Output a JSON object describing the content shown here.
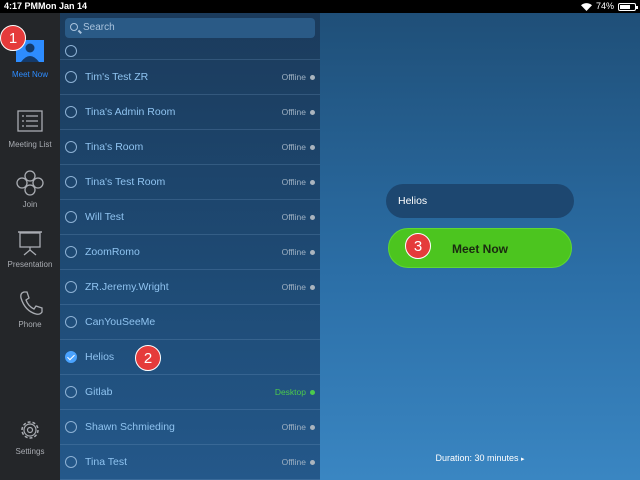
{
  "status_bar": {
    "time": "4:17 PM",
    "date": "Mon Jan 14",
    "battery": "74%",
    "battery_level": 0.74
  },
  "rail": {
    "items": [
      {
        "label": "Meet Now",
        "icon": "person-icon",
        "active": true
      },
      {
        "label": "Meeting List",
        "icon": "list-icon",
        "active": false
      },
      {
        "label": "Join",
        "icon": "join-icon",
        "active": false
      },
      {
        "label": "Presentation",
        "icon": "presentation-icon",
        "active": false
      },
      {
        "label": "Phone",
        "icon": "phone-icon",
        "active": false
      }
    ],
    "settings_label": "Settings"
  },
  "search": {
    "placeholder": "Search"
  },
  "rooms": [
    {
      "name": "Tim's Test ZR",
      "status": "Offline",
      "checked": false
    },
    {
      "name": "Tina's Admin Room",
      "status": "Offline",
      "checked": false
    },
    {
      "name": "Tina's Room",
      "status": "Offline",
      "checked": false
    },
    {
      "name": "Tina's Test Room",
      "status": "Offline",
      "checked": false
    },
    {
      "name": "Will Test",
      "status": "Offline",
      "checked": false
    },
    {
      "name": "ZoomRomo",
      "status": "Offline",
      "checked": false
    },
    {
      "name": "ZR.Jeremy.Wright",
      "status": "Offline",
      "checked": false
    },
    {
      "name": "CanYouSeeMe",
      "status": "",
      "checked": false
    },
    {
      "name": "Helios",
      "status": "",
      "checked": true
    },
    {
      "name": "Gitlab",
      "status": "Desktop",
      "checked": false
    },
    {
      "name": "Shawn Schmieding",
      "status": "Offline",
      "checked": false
    },
    {
      "name": "Tina Test",
      "status": "Offline",
      "checked": false
    }
  ],
  "main": {
    "selected_room": "Helios",
    "meet_now_label": "Meet Now",
    "duration_label": "Duration: 30 minutes"
  },
  "badges": [
    "1",
    "2",
    "3"
  ],
  "colors": {
    "accent": "#2d8cff",
    "meet_button": "#4cc51f",
    "badge": "#e53b3b",
    "desktop_status": "#4cc94c"
  }
}
